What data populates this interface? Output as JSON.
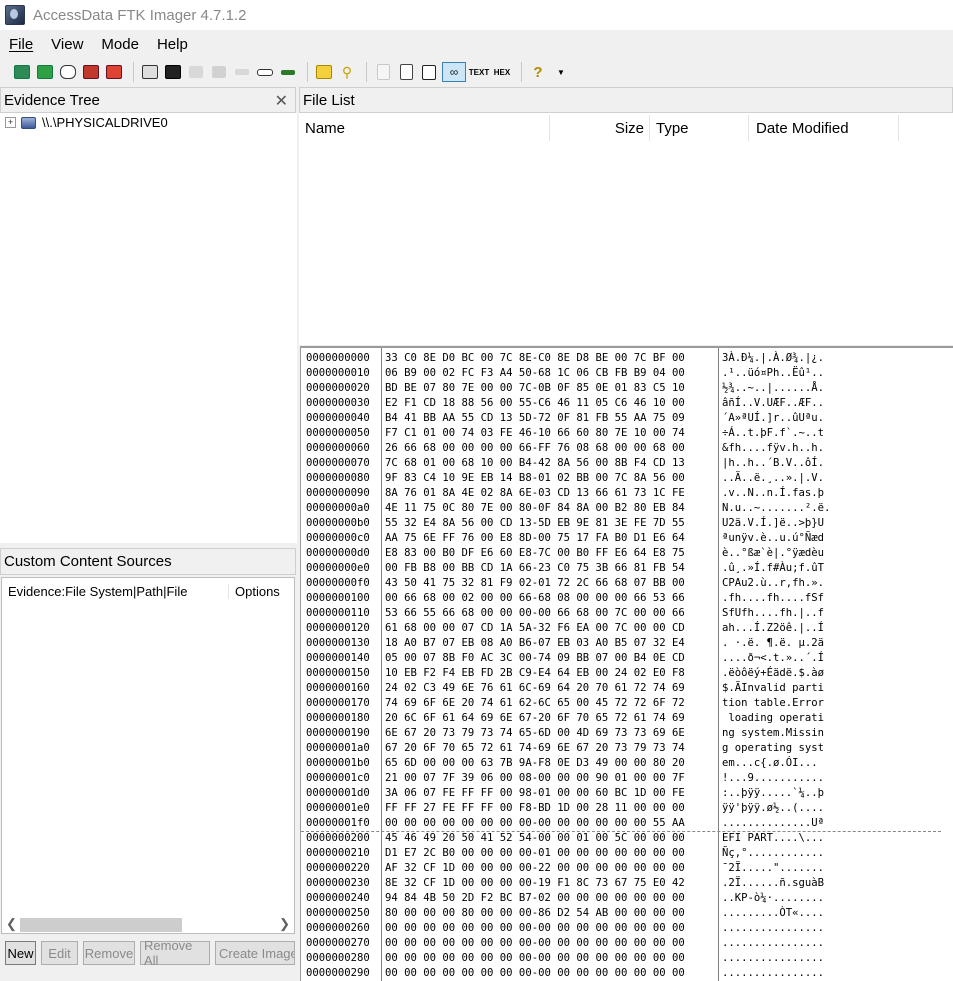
{
  "window": {
    "title": "AccessData FTK Imager 4.7.1.2"
  },
  "menu": [
    "File",
    "View",
    "Mode",
    "Help"
  ],
  "toolbar": {
    "icons": [
      "add-evidence-icon",
      "add-all-attached-devices-icon",
      "image-mounting-icon",
      "remove-evidence-icon",
      "remove-all-evidence-icon",
      "create-disk-image-icon",
      "export-disk-image-icon",
      "export-logical-image-icon",
      "add-to-custom-content-icon",
      "create-custom-content-image-icon",
      "decrypt-ad1-icon",
      "detect-encryption-icon",
      "export-files-icon",
      "export-file-hash-list-icon",
      "export-directory-listing-icon",
      "verify-drive-icon",
      "capture-memory-icon",
      "obtain-protected-files-icon",
      "auto-preview-icon",
      "text-view-icon",
      "hex-view-icon",
      "help-icon",
      "dropdown-icon"
    ],
    "text_label": "TEXT",
    "hex_label": "HEX"
  },
  "evidence_tree": {
    "title": "Evidence Tree",
    "items": [
      {
        "label": "\\\\.\\PHYSICALDRIVE0"
      }
    ]
  },
  "file_list": {
    "title": "File List",
    "columns": [
      "Name",
      "Size",
      "Type",
      "Date Modified"
    ]
  },
  "custom_content": {
    "title": "Custom Content Sources",
    "columns": [
      "Evidence:File System|Path|File",
      "Options"
    ],
    "buttons": [
      "New",
      "Edit",
      "Remove",
      "Remove All",
      "Create Image"
    ]
  },
  "hex_view": {
    "rows": [
      {
        "offset": "0000000000",
        "hex": "33 C0 8E D0 BC 00 7C 8E-C0 8E D8 BE 00 7C BF 00",
        "ascii": "3À.Ð¼.|.À.Ø¾.|¿."
      },
      {
        "offset": "0000000010",
        "hex": "06 B9 00 02 FC F3 A4 50-68 1C 06 CB FB B9 04 00",
        "ascii": ".¹..üó¤Ph..Ëû¹.."
      },
      {
        "offset": "0000000020",
        "hex": "BD BE 07 80 7E 00 00 7C-0B 0F 85 0E 01 83 C5 10",
        "ascii": "½¾..~..|......Å."
      },
      {
        "offset": "0000000030",
        "hex": "E2 F1 CD 18 88 56 00 55-C6 46 11 05 C6 46 10 00",
        "ascii": "âñÍ..V.UÆF..ÆF.."
      },
      {
        "offset": "0000000040",
        "hex": "B4 41 BB AA 55 CD 13 5D-72 0F 81 FB 55 AA 75 09",
        "ascii": "´A»ªUÍ.]r..ûUªu."
      },
      {
        "offset": "0000000050",
        "hex": "F7 C1 01 00 74 03 FE 46-10 66 60 80 7E 10 00 74",
        "ascii": "÷Á..t.þF.f`.~..t"
      },
      {
        "offset": "0000000060",
        "hex": "26 66 68 00 00 00 00 66-FF 76 08 68 00 00 68 00",
        "ascii": "&fh....fÿv.h..h."
      },
      {
        "offset": "0000000070",
        "hex": "7C 68 01 00 68 10 00 B4-42 8A 56 00 8B F4 CD 13",
        "ascii": "|h..h..´B.V..ôÍ."
      },
      {
        "offset": "0000000080",
        "hex": "9F 83 C4 10 9E EB 14 B8-01 02 BB 00 7C 8A 56 00",
        "ascii": "..Ä..ë.¸..».|.V."
      },
      {
        "offset": "0000000090",
        "hex": "8A 76 01 8A 4E 02 8A 6E-03 CD 13 66 61 73 1C FE",
        "ascii": ".v..N..n.Í.fas.þ"
      },
      {
        "offset": "00000000a0",
        "hex": "4E 11 75 0C 80 7E 00 80-0F 84 8A 00 B2 80 EB 84",
        "ascii": "N.u..~.......².ë."
      },
      {
        "offset": "00000000b0",
        "hex": "55 32 E4 8A 56 00 CD 13-5D EB 9E 81 3E FE 7D 55",
        "ascii": "U2ä.V.Í.]ë..>þ}U"
      },
      {
        "offset": "00000000c0",
        "hex": "AA 75 6E FF 76 00 E8 8D-00 75 17 FA B0 D1 E6 64",
        "ascii": "ªunÿv.è..u.ú°Ñæd"
      },
      {
        "offset": "00000000d0",
        "hex": "E8 83 00 B0 DF E6 60 E8-7C 00 B0 FF E6 64 E8 75",
        "ascii": "è..°ßæ`è|.°ÿædèu"
      },
      {
        "offset": "00000000e0",
        "hex": "00 FB B8 00 BB CD 1A 66-23 C0 75 3B 66 81 FB 54",
        "ascii": ".û¸.»Í.f#Àu;f.ûT"
      },
      {
        "offset": "00000000f0",
        "hex": "43 50 41 75 32 81 F9 02-01 72 2C 66 68 07 BB 00",
        "ascii": "CPAu2.ù..r,fh.»."
      },
      {
        "offset": "0000000100",
        "hex": "00 66 68 00 02 00 00 66-68 08 00 00 00 66 53 66",
        "ascii": ".fh....fh....fSf"
      },
      {
        "offset": "0000000110",
        "hex": "53 66 55 66 68 00 00 00-00 66 68 00 7C 00 00 66",
        "ascii": "SfUfh....fh.|..f"
      },
      {
        "offset": "0000000120",
        "hex": "61 68 00 00 07 CD 1A 5A-32 F6 EA 00 7C 00 00 CD",
        "ascii": "ah...Í.Z2öê.|..Í"
      },
      {
        "offset": "0000000130",
        "hex": "18 A0 B7 07 EB 08 A0 B6-07 EB 03 A0 B5 07 32 E4",
        "ascii": ". ·.ë. ¶.ë. µ.2ä"
      },
      {
        "offset": "0000000140",
        "hex": "05 00 07 8B F0 AC 3C 00-74 09 BB 07 00 B4 0E CD",
        "ascii": "....ð¬<.t.»..´.Í"
      },
      {
        "offset": "0000000150",
        "hex": "10 EB F2 F4 EB FD 2B C9-E4 64 EB 00 24 02 E0 F8",
        "ascii": ".ëòôëý+Éädë.$.àø"
      },
      {
        "offset": "0000000160",
        "hex": "24 02 C3 49 6E 76 61 6C-69 64 20 70 61 72 74 69",
        "ascii": "$.ÃInvalid parti"
      },
      {
        "offset": "0000000170",
        "hex": "74 69 6F 6E 20 74 61 62-6C 65 00 45 72 72 6F 72",
        "ascii": "tion table.Error"
      },
      {
        "offset": "0000000180",
        "hex": "20 6C 6F 61 64 69 6E 67-20 6F 70 65 72 61 74 69",
        "ascii": " loading operati"
      },
      {
        "offset": "0000000190",
        "hex": "6E 67 20 73 79 73 74 65-6D 00 4D 69 73 73 69 6E",
        "ascii": "ng system.Missin"
      },
      {
        "offset": "00000001a0",
        "hex": "67 20 6F 70 65 72 61 74-69 6E 67 20 73 79 73 74",
        "ascii": "g operating syst"
      },
      {
        "offset": "00000001b0",
        "hex": "65 6D 00 00 00 63 7B 9A-F8 0E D3 49 00 00 80 20",
        "ascii": "em...c{.ø.ÓI... "
      },
      {
        "offset": "00000001c0",
        "hex": "21 00 07 7F 39 06 00 08-00 00 00 90 01 00 00 7F",
        "ascii": "!...9..........."
      },
      {
        "offset": "00000001d0",
        "hex": "3A 06 07 FE FF FF 00 98-01 00 00 60 BC 1D 00 FE",
        "ascii": ":..þÿÿ.....`¼..þ"
      },
      {
        "offset": "00000001e0",
        "hex": "FF FF 27 FE FF FF 00 F8-BD 1D 00 28 11 00 00 00",
        "ascii": "ÿÿ'þÿÿ.ø½..(...."
      },
      {
        "offset": "00000001f0",
        "hex": "00 00 00 00 00 00 00 00-00 00 00 00 00 00 55 AA",
        "ascii": "..............Uª"
      },
      {
        "offset": "0000000200",
        "hex": "45 46 49 20 50 41 52 54-00 00 01 00 5C 00 00 00",
        "ascii": "EFI PART....\\..."
      },
      {
        "offset": "0000000210",
        "hex": "D1 E7 2C B0 00 00 00 00-01 00 00 00 00 00 00 00",
        "ascii": "Ñç,°............"
      },
      {
        "offset": "0000000220",
        "hex": "AF 32 CF 1D 00 00 00 00-22 00 00 00 00 00 00 00",
        "ascii": "¯2Ï.....\"......."
      },
      {
        "offset": "0000000230",
        "hex": "8E 32 CF 1D 00 00 00 00-19 F1 8C 73 67 75 E0 42",
        "ascii": ".2Ï......ñ.sguàB"
      },
      {
        "offset": "0000000240",
        "hex": "94 84 4B 50 2D F2 BC B7-02 00 00 00 00 00 00 00",
        "ascii": "..KP-ò¼·........"
      },
      {
        "offset": "0000000250",
        "hex": "80 00 00 00 80 00 00 00-86 D2 54 AB 00 00 00 00",
        "ascii": ".........ÒT«...."
      },
      {
        "offset": "0000000260",
        "hex": "00 00 00 00 00 00 00 00-00 00 00 00 00 00 00 00",
        "ascii": "................"
      },
      {
        "offset": "0000000270",
        "hex": "00 00 00 00 00 00 00 00-00 00 00 00 00 00 00 00",
        "ascii": "................"
      },
      {
        "offset": "0000000280",
        "hex": "00 00 00 00 00 00 00 00-00 00 00 00 00 00 00 00",
        "ascii": "................"
      },
      {
        "offset": "0000000290",
        "hex": "00 00 00 00 00 00 00 00-00 00 00 00 00 00 00 00",
        "ascii": "................"
      }
    ]
  },
  "colors": {
    "accent": "#3c7fb1",
    "panel_bg": "#f0f0f0"
  }
}
